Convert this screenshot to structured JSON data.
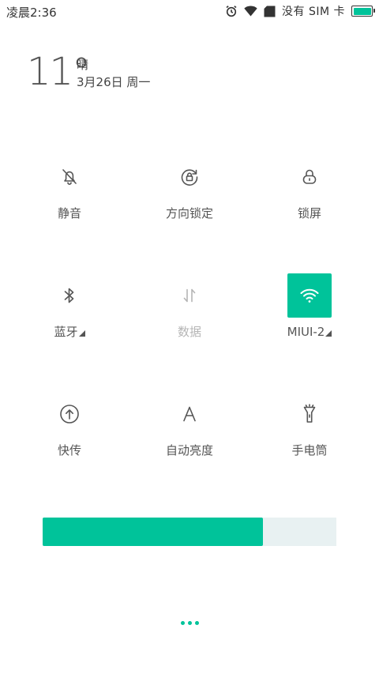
{
  "status_bar": {
    "time": "凌晨2:36",
    "carrier": "没有 SIM 卡",
    "battery_level": 1.0,
    "icons": [
      "alarm-icon",
      "wifi-icon",
      "sim-card-icon",
      "battery-icon"
    ]
  },
  "weather": {
    "temperature": "11°",
    "condition": "晴",
    "date": "3月26日 周一"
  },
  "tiles": [
    {
      "label": "静音",
      "icon": "bell-off-icon",
      "state": "off"
    },
    {
      "label": "方向锁定",
      "icon": "rotation-lock-icon",
      "state": "off"
    },
    {
      "label": "锁屏",
      "icon": "lock-icon",
      "state": "off"
    },
    {
      "label": "蓝牙",
      "icon": "bluetooth-icon",
      "state": "off",
      "has_submenu": true
    },
    {
      "label": "数据",
      "icon": "mobile-data-icon",
      "state": "disabled"
    },
    {
      "label": "MIUI-2",
      "icon": "wifi-icon",
      "state": "on",
      "has_submenu": true
    },
    {
      "label": "快传",
      "icon": "quick-transfer-icon",
      "state": "off"
    },
    {
      "label": "自动亮度",
      "icon": "auto-brightness-icon",
      "state": "off"
    },
    {
      "label": "手电筒",
      "icon": "flashlight-icon",
      "state": "off"
    }
  ],
  "brightness": {
    "level": 0.75
  },
  "pager": {
    "pages": 3
  },
  "colors": {
    "accent": "#00c39a",
    "track": "#e8f1f2",
    "icon": "#555555",
    "disabled": "#b5b5b5"
  }
}
